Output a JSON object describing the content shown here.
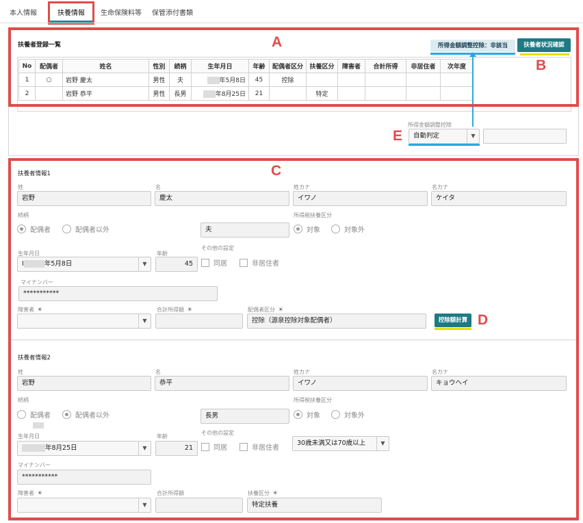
{
  "tabs": [
    {
      "label": "本人情報"
    },
    {
      "label": "扶養情報"
    },
    {
      "label": "生命保険料等"
    },
    {
      "label": "保管添付書類"
    }
  ],
  "markers": {
    "a": "A",
    "b": "B",
    "c": "C",
    "d": "D",
    "e": "E"
  },
  "list": {
    "title": "扶養者登録一覧",
    "income_adjust_status": "所得金額調整控除：非該当",
    "status_button": "扶養者状況確認",
    "headers": [
      "No",
      "配偶者",
      "姓名",
      "性別",
      "続柄",
      "生年月日",
      "年齢",
      "配偶者区分",
      "扶養区分",
      "障害者",
      "合計所得",
      "非居住者",
      "次年度"
    ],
    "rows": [
      [
        "1",
        "○",
        "岩野 慶太",
        "男性",
        "夫",
        "年5月8日",
        "45",
        "控除",
        "",
        "",
        "",
        "",
        ""
      ],
      [
        "2",
        "",
        "岩野 恭平",
        "男性",
        "長男",
        "年8月25日",
        "21",
        "",
        "特定",
        "",
        "",
        "",
        ""
      ]
    ]
  },
  "adjust": {
    "label": "所得金額調整控除",
    "value": "自動判定",
    "extra": ""
  },
  "labels": {
    "sei": "姓",
    "mei": "名",
    "sei_kana": "姓カナ",
    "mei_kana": "名カナ",
    "relation": "続柄",
    "tax_dependent": "所得税扶養区分",
    "spouse": "配偶者",
    "not_spouse": "配偶者以外",
    "target": "対象",
    "not_target": "対象外",
    "birth": "生年月日",
    "age": "年齢",
    "other_settings": "その他の設定",
    "cohabit": "同居",
    "non_resident": "非居住者",
    "my_number": "マイナンバー",
    "disabled": "障害者",
    "total_income": "合計所得額",
    "spouse_category": "配偶者区分",
    "dependent_category": "扶養区分"
  },
  "dep1": {
    "title": "扶養者情報1",
    "sei": "岩野",
    "mei": "慶太",
    "sei_kana": "イワノ",
    "mei_kana": "ケイタ",
    "relation": "夫",
    "birth": "年5月8日",
    "birth_prefix": "I",
    "age": "45",
    "my_number": "***********",
    "disabled": "",
    "total_income": "",
    "spouse_category": "控除（源泉控除対象配偶者）",
    "calc_button": "控除額計算"
  },
  "dep2": {
    "title": "扶養者情報2",
    "sei": "岩野",
    "mei": "恭平",
    "sei_kana": "イワノ",
    "mei_kana": "キョウヘイ",
    "relation": "長男",
    "birth": "年8月25日",
    "age": "21",
    "age_bracket": "30歳未満又は70歳以上",
    "my_number": "***********",
    "disabled": "",
    "total_income": "",
    "dependent_category": "特定扶養"
  }
}
